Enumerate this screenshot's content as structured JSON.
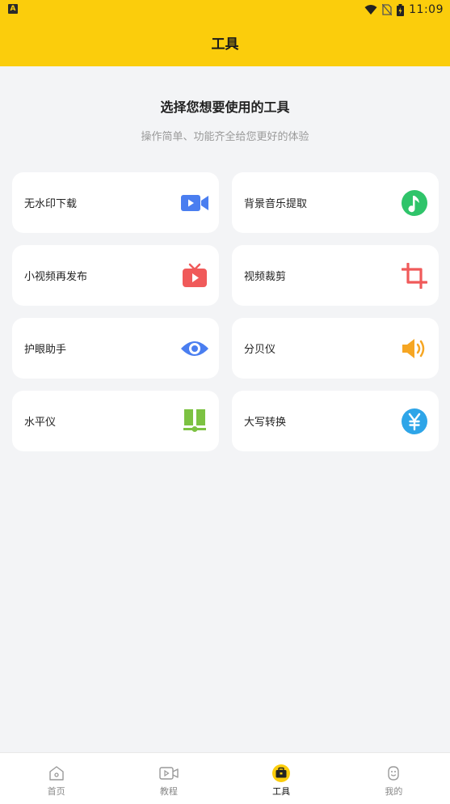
{
  "status_bar": {
    "app_badge": "A",
    "time": "11:09"
  },
  "header": {
    "title": "工具"
  },
  "intro": {
    "title": "选择您想要使用的工具",
    "subtitle": "操作简单、功能齐全给您更好的体验"
  },
  "tools": [
    {
      "label": "无水印下载",
      "icon": "video-camera-icon",
      "color": "#4a7ef0"
    },
    {
      "label": "背景音乐提取",
      "icon": "music-note-icon",
      "color": "#2fc46a"
    },
    {
      "label": "小视频再发布",
      "icon": "tv-play-icon",
      "color": "#f05a5a"
    },
    {
      "label": "视频裁剪",
      "icon": "crop-icon",
      "color": "#f05a5a"
    },
    {
      "label": "护眼助手",
      "icon": "eye-icon",
      "color": "#4a7ef0"
    },
    {
      "label": "分贝仪",
      "icon": "speaker-icon",
      "color": "#f6a623"
    },
    {
      "label": "水平仪",
      "icon": "level-icon",
      "color": "#7cc242"
    },
    {
      "label": "大写转换",
      "icon": "yuan-icon",
      "color": "#2ea5e8"
    }
  ],
  "tabbar": {
    "items": [
      {
        "label": "首页",
        "icon": "home-icon",
        "active": false
      },
      {
        "label": "教程",
        "icon": "video-icon",
        "active": false
      },
      {
        "label": "工具",
        "icon": "toolbox-icon",
        "active": true
      },
      {
        "label": "我的",
        "icon": "profile-icon",
        "active": false
      }
    ]
  },
  "colors": {
    "accent": "#fbcd0c",
    "background": "#f3f4f6"
  }
}
